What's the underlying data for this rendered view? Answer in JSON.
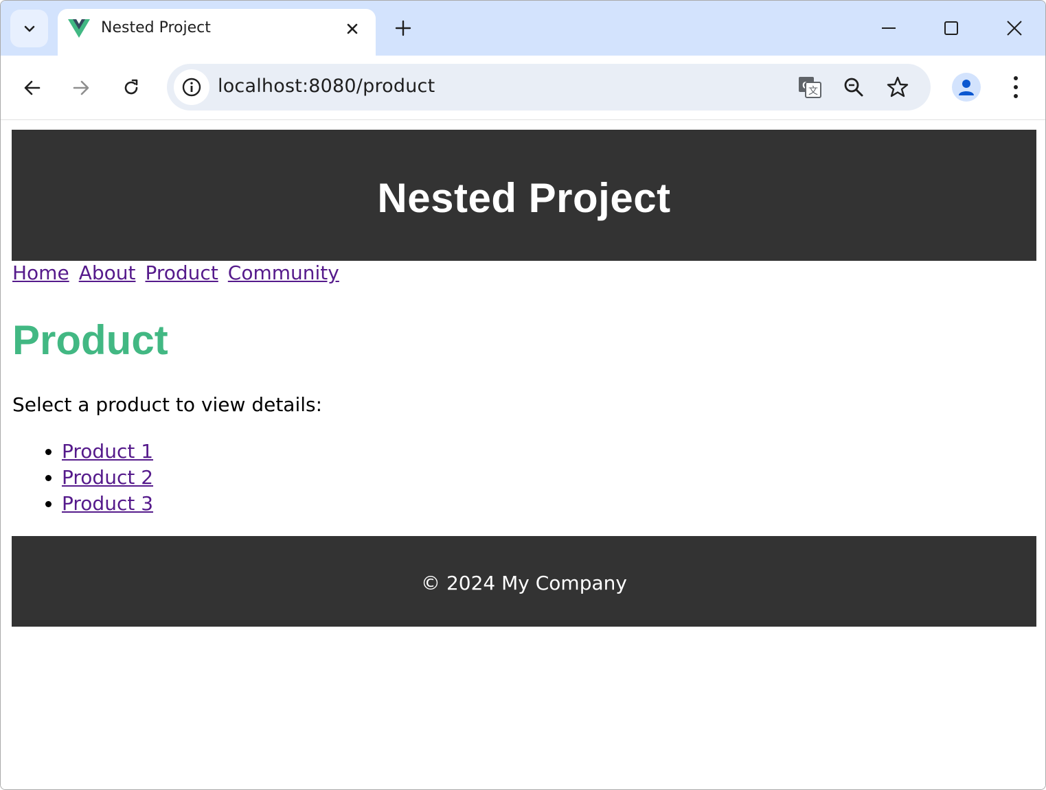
{
  "browser": {
    "tab": {
      "title": "Nested Project",
      "favicon": "vue-logo-icon"
    },
    "address_bar": {
      "url": "localhost:8080/product"
    },
    "icons": [
      "chevron-down-icon",
      "close-icon",
      "plus-icon",
      "minimize-icon",
      "maximize-icon",
      "window-close-icon",
      "back-icon",
      "forward-icon",
      "reload-icon",
      "site-info-icon",
      "translate-icon",
      "zoom-icon",
      "bookmark-star-icon",
      "profile-icon",
      "more-menu-icon"
    ]
  },
  "page": {
    "header_title": "Nested Project",
    "nav": [
      {
        "label": "Home"
      },
      {
        "label": "About"
      },
      {
        "label": "Product"
      },
      {
        "label": "Community"
      }
    ],
    "heading": "Product",
    "intro": "Select a product to view details:",
    "products": [
      {
        "label": "Product 1"
      },
      {
        "label": "Product 2"
      },
      {
        "label": "Product 3"
      }
    ],
    "footer": "© 2024 My Company"
  },
  "colors": {
    "header_bg": "#333333",
    "heading": "#42b883",
    "link": "#551a8b",
    "titlebar": "#d3e3fd",
    "omnibox": "#e9eef6"
  }
}
